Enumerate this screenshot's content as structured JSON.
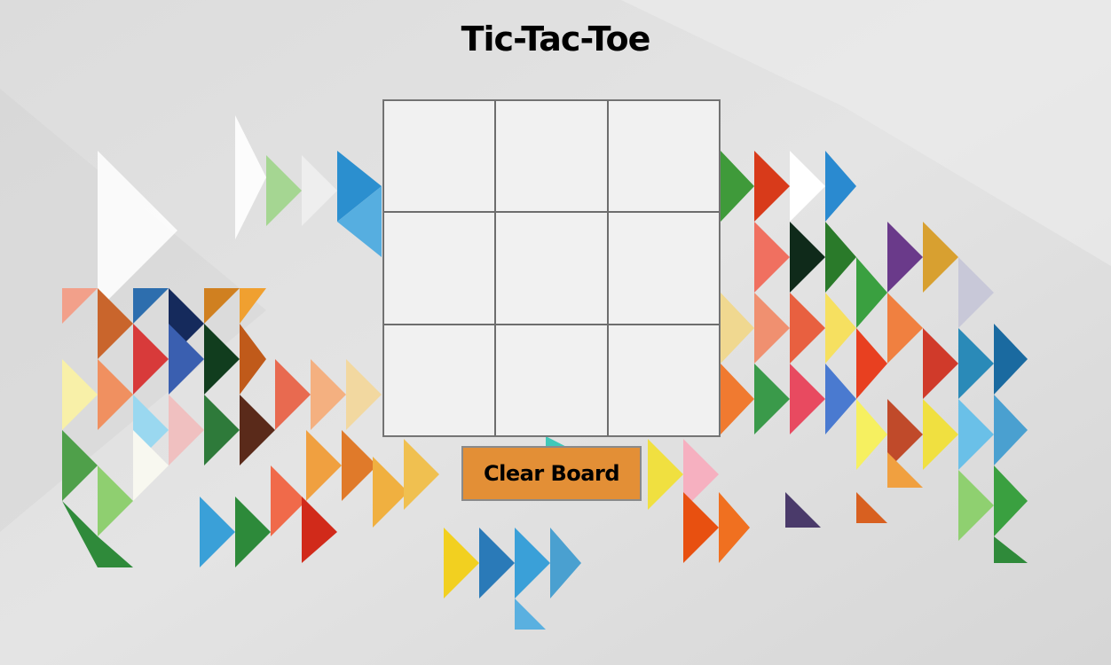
{
  "game": {
    "title": "Tic-Tac-Toe",
    "board": {
      "cells": [
        "",
        "",
        "",
        "",
        "",
        "",
        "",
        "",
        ""
      ]
    },
    "clear_button_label": "Clear Board"
  },
  "colors": {
    "page_background": "#d9d9d9",
    "cell_background": "#f1f1f1",
    "grid_line": "#6d6d6d",
    "button_background": "#e38f36",
    "button_border": "#8a8a8a",
    "title_text": "#000000"
  }
}
